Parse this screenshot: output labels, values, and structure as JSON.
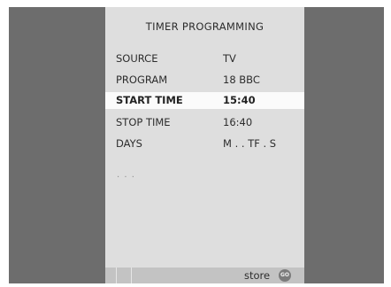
{
  "menu": {
    "title": "TIMER  PROGRAMMING",
    "rows": [
      {
        "label": "SOURCE",
        "value": "TV"
      },
      {
        "label": "PROGRAM",
        "value": "18  BBC"
      },
      {
        "label": "START TIME",
        "value": "15:40"
      },
      {
        "label": "STOP TIME",
        "value": "16:40"
      },
      {
        "label": "DAYS",
        "value": "M . . TF . S"
      }
    ],
    "selected_row": "START TIME",
    "ellipsis": ". . ."
  },
  "footer": {
    "store_label": "store",
    "go_label": "GO"
  },
  "colors": {
    "background": "#6d6d6d",
    "menu_panel": "#dedede",
    "selected_row": "#fbfbfb",
    "footer_bar": "#c3c3c3"
  }
}
